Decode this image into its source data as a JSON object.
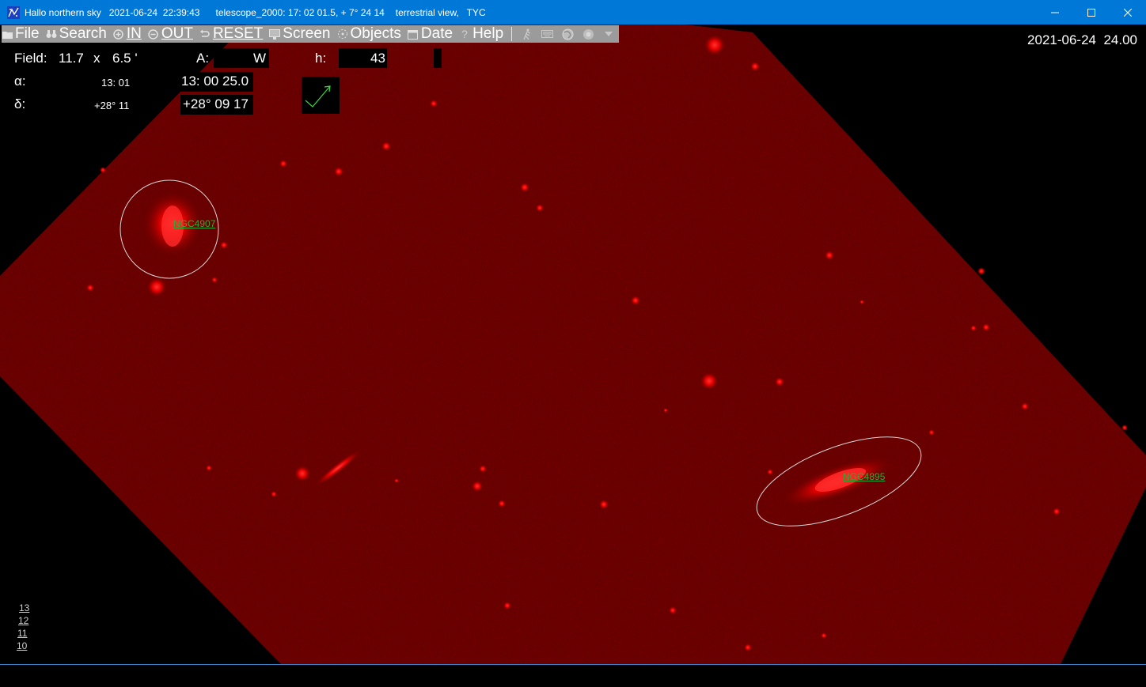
{
  "window": {
    "title": "Hallo northern sky",
    "datetime": "2021-06-24  22:39:43",
    "telescope": "telescope_2000: 17: 02 01.5, + 7° 24 14",
    "view": "terrestrial view,   TYC",
    "controls": [
      "minimize",
      "maximize",
      "close"
    ]
  },
  "menu": {
    "items": [
      {
        "label": "File",
        "icon": "folder-icon"
      },
      {
        "label": "Search",
        "icon": "binoculars-icon"
      },
      {
        "label": "IN",
        "icon": "zoom-in-icon"
      },
      {
        "label": "OUT",
        "icon": "zoom-out-icon"
      },
      {
        "label": "RESET",
        "icon": "reset-icon"
      },
      {
        "label": "Screen",
        "icon": "monitor-icon"
      },
      {
        "label": "Objects",
        "icon": "objects-icon"
      },
      {
        "label": "Date",
        "icon": "calendar-icon"
      },
      {
        "label": "Help",
        "icon": "help-icon"
      }
    ],
    "tools": [
      "walker-icon",
      "keyboard-icon",
      "globe-icon",
      "circle-icon",
      "dropdown-icon"
    ]
  },
  "info": {
    "field_label": "Field:",
    "field_w": "11.7",
    "field_x": "x",
    "field_h": "6.5 '",
    "az_label": "A:",
    "az_value": "W",
    "h_label": "h:",
    "h_value": "43",
    "alpha_label": "α:",
    "alpha_small": "13: 01",
    "alpha_value": "13: 00 25.0",
    "delta_label": "δ:",
    "delta_small": "+28° 11",
    "delta_value": "+28° 09 17",
    "date_time": "2021-06-24  24.00"
  },
  "objects": [
    {
      "name": "NGC4907"
    },
    {
      "name": "NGC4895"
    }
  ],
  "scale": [
    "13",
    "12",
    "11",
    "10"
  ],
  "colors": {
    "titlebar": "#0078d7",
    "menubar": "#9b9b9b",
    "sky_red": "#e00000",
    "label_green": "#2faa2f"
  }
}
